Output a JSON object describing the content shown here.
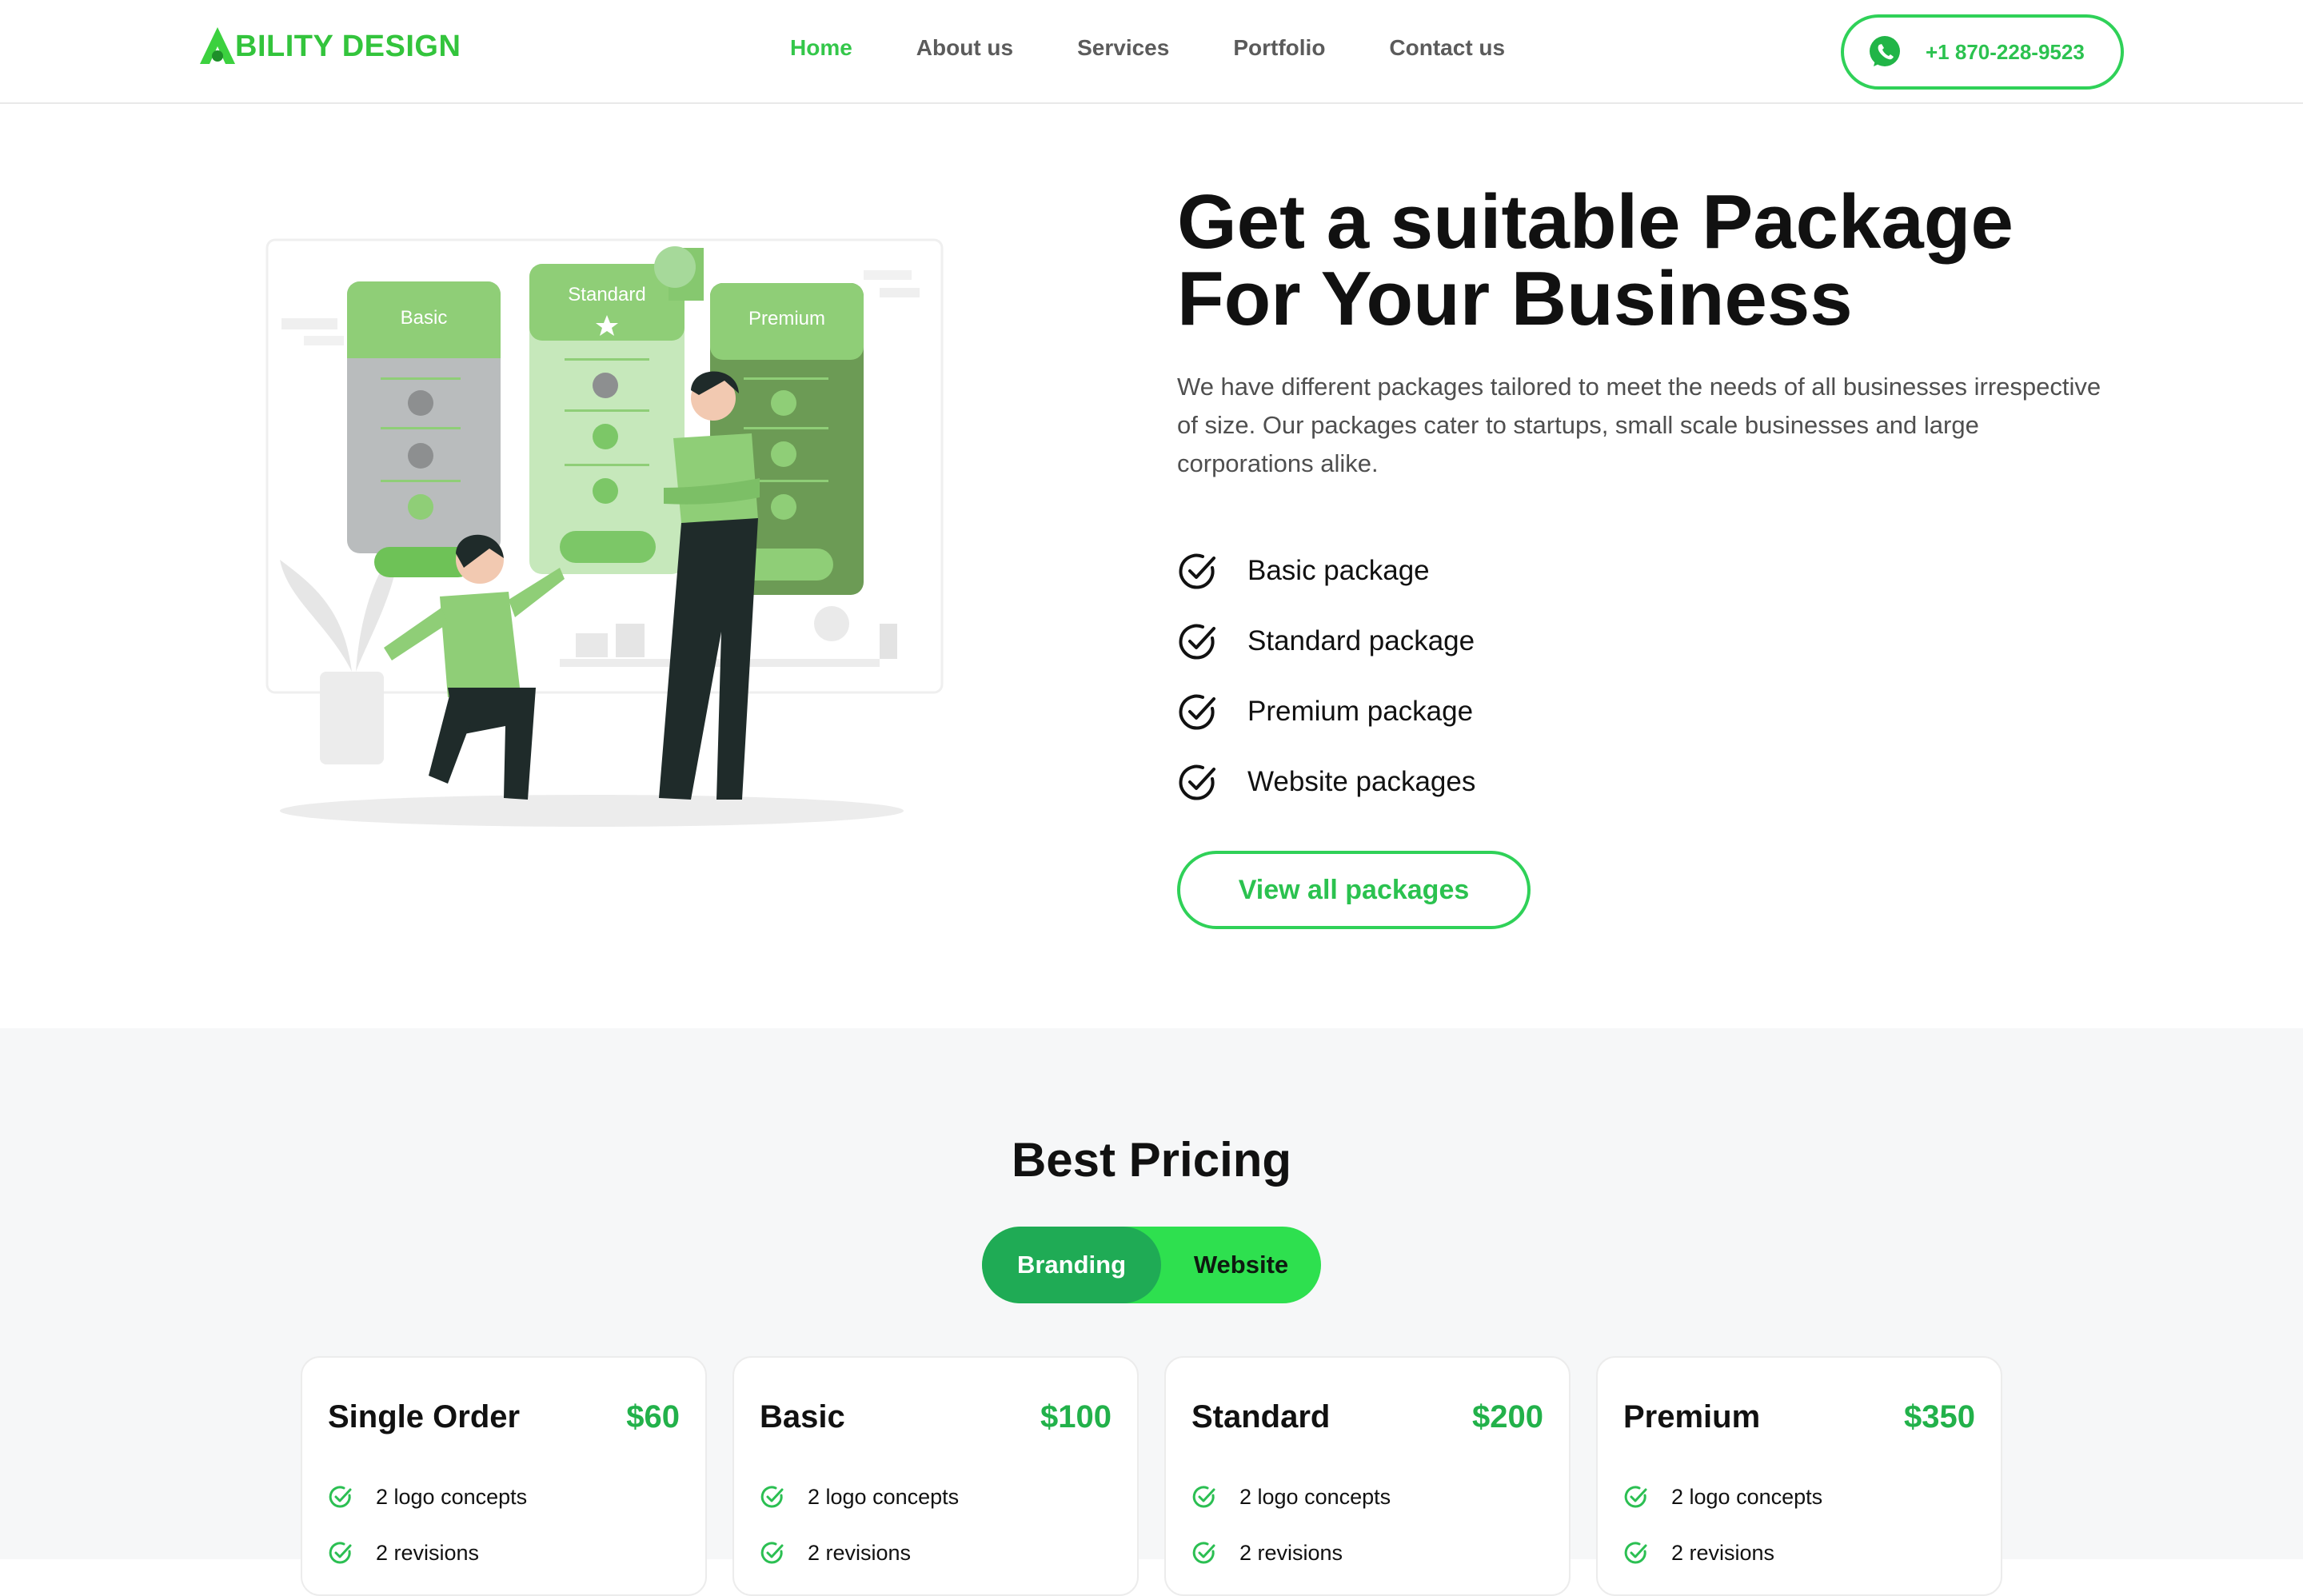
{
  "brand": {
    "name": "BILITY DESIGN",
    "color": "#33c43c"
  },
  "nav": {
    "items": [
      {
        "label": "Home",
        "active": true
      },
      {
        "label": "About us"
      },
      {
        "label": "Services"
      },
      {
        "label": "Portfolio"
      },
      {
        "label": "Contact us"
      }
    ],
    "phone": "+1 870-228-9523",
    "phone_icon": "whatsapp-icon"
  },
  "hero": {
    "title_line1": "Get a suitable Package",
    "title_line2": "For Your Business",
    "description": "We have different packages tailored to meet the needs of all businesses irrespective of size. Our packages cater to startups, small scale businesses and large corporations alike.",
    "packages": [
      "Basic package",
      "Standard package",
      "Premium package",
      "Website packages"
    ],
    "cta": "View all packages",
    "illustration": {
      "cards": [
        {
          "label": "Basic"
        },
        {
          "label": "Standard"
        },
        {
          "label": "Premium"
        }
      ]
    }
  },
  "pricing": {
    "title": "Best Pricing",
    "toggle": {
      "active": "Branding",
      "inactive": "Website"
    },
    "plans": [
      {
        "name": "Single Order",
        "price": "$60",
        "features": [
          "2 logo concepts",
          "2 revisions"
        ]
      },
      {
        "name": "Basic",
        "price": "$100",
        "features": [
          "2 logo concepts",
          "2 revisions"
        ]
      },
      {
        "name": "Standard",
        "price": "$200",
        "features": [
          "2 logo concepts",
          "2 revisions"
        ]
      },
      {
        "name": "Premium",
        "price": "$350",
        "features": [
          "2 logo concepts",
          "2 revisions"
        ]
      }
    ]
  },
  "colors": {
    "accent": "#2fd158",
    "accent_dark": "#1fab55",
    "text": "#111111",
    "muted": "#4f4f4f"
  }
}
